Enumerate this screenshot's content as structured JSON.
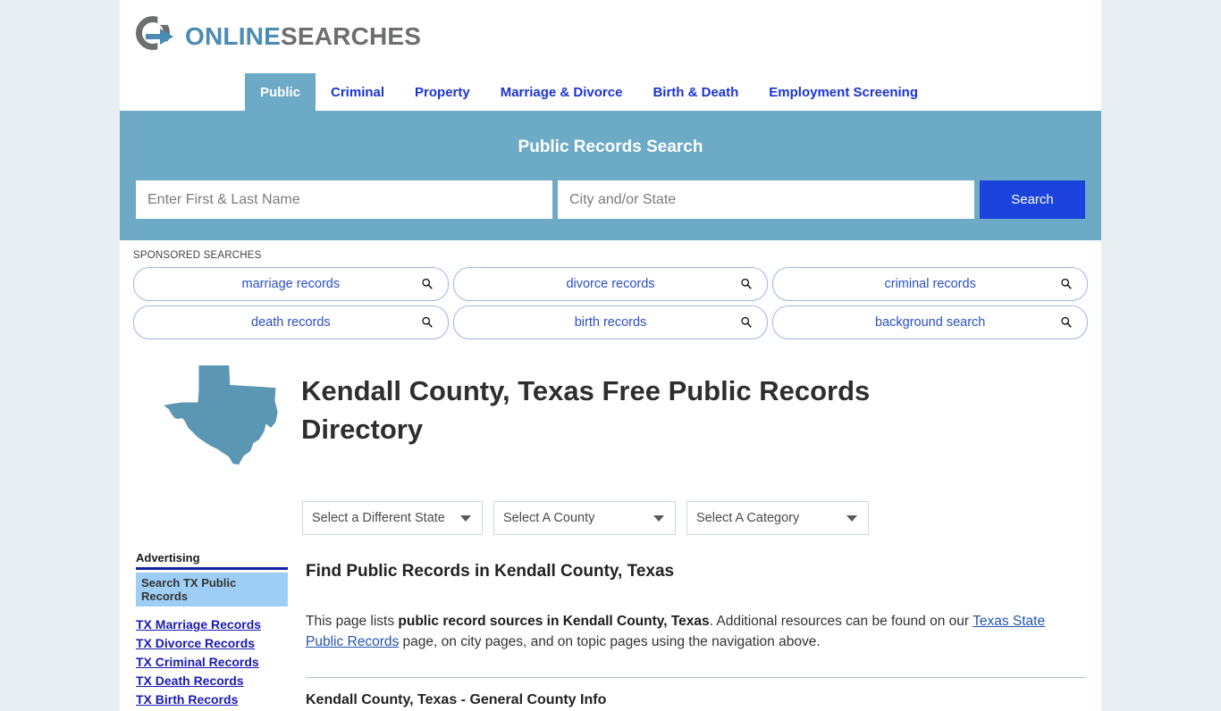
{
  "site": {
    "logo_primary": "ONLINE",
    "logo_secondary": "SEARCHES",
    "logo_icon": "circle-arrow-icon",
    "brand_blue": "#4a8cb3",
    "brand_gray": "#6d6e70"
  },
  "nav": {
    "items": [
      {
        "label": "Public",
        "active": true
      },
      {
        "label": "Criminal",
        "active": false
      },
      {
        "label": "Property",
        "active": false
      },
      {
        "label": "Marriage & Divorce",
        "active": false
      },
      {
        "label": "Birth & Death",
        "active": false
      },
      {
        "label": "Employment Screening",
        "active": false
      }
    ]
  },
  "search_banner": {
    "title": "Public Records Search",
    "name_placeholder": "Enter First & Last Name",
    "name_value": "",
    "city_placeholder": "City and/or State",
    "city_value": "",
    "button_label": "Search",
    "button_color": "#1b43dc",
    "background_color": "#6caac6"
  },
  "sponsored": {
    "label": "SPONSORED SEARCHES",
    "rows": [
      [
        {
          "label": "marriage records",
          "icon": "search-icon"
        },
        {
          "label": "divorce records",
          "icon": "search-icon"
        },
        {
          "label": "criminal records",
          "icon": "search-icon"
        }
      ],
      [
        {
          "label": "death records",
          "icon": "search-icon"
        },
        {
          "label": "birth records",
          "icon": "search-icon"
        },
        {
          "label": "background search",
          "icon": "search-icon"
        }
      ]
    ]
  },
  "hero": {
    "map_icon": "texas-state-map-icon",
    "map_color": "#5b96b3",
    "title": "Kendall County, Texas Free Public Records Directory"
  },
  "selectors": {
    "state": "Select a Different State",
    "county": "Select A County",
    "category": "Select A Category"
  },
  "sidebar": {
    "advertising_title": "Advertising",
    "promo_label": "Search TX Public Records",
    "links": [
      {
        "label": "TX Marriage Records"
      },
      {
        "label": "TX Divorce Records"
      },
      {
        "label": "TX Criminal Records"
      },
      {
        "label": "TX Death Records"
      },
      {
        "label": "TX Birth Records"
      }
    ]
  },
  "content": {
    "heading": "Find Public Records in Kendall County, Texas",
    "paragraph": {
      "part1": "This page lists ",
      "bold1": "public record sources in Kendall County, Texas",
      "part2": ". Additional resources can be found on our ",
      "link1": "Texas State Public Records",
      "part3": " page, on city pages, and on topic pages using the navigation above."
    },
    "section_heading": "Kendall County, Texas - General County Info"
  }
}
